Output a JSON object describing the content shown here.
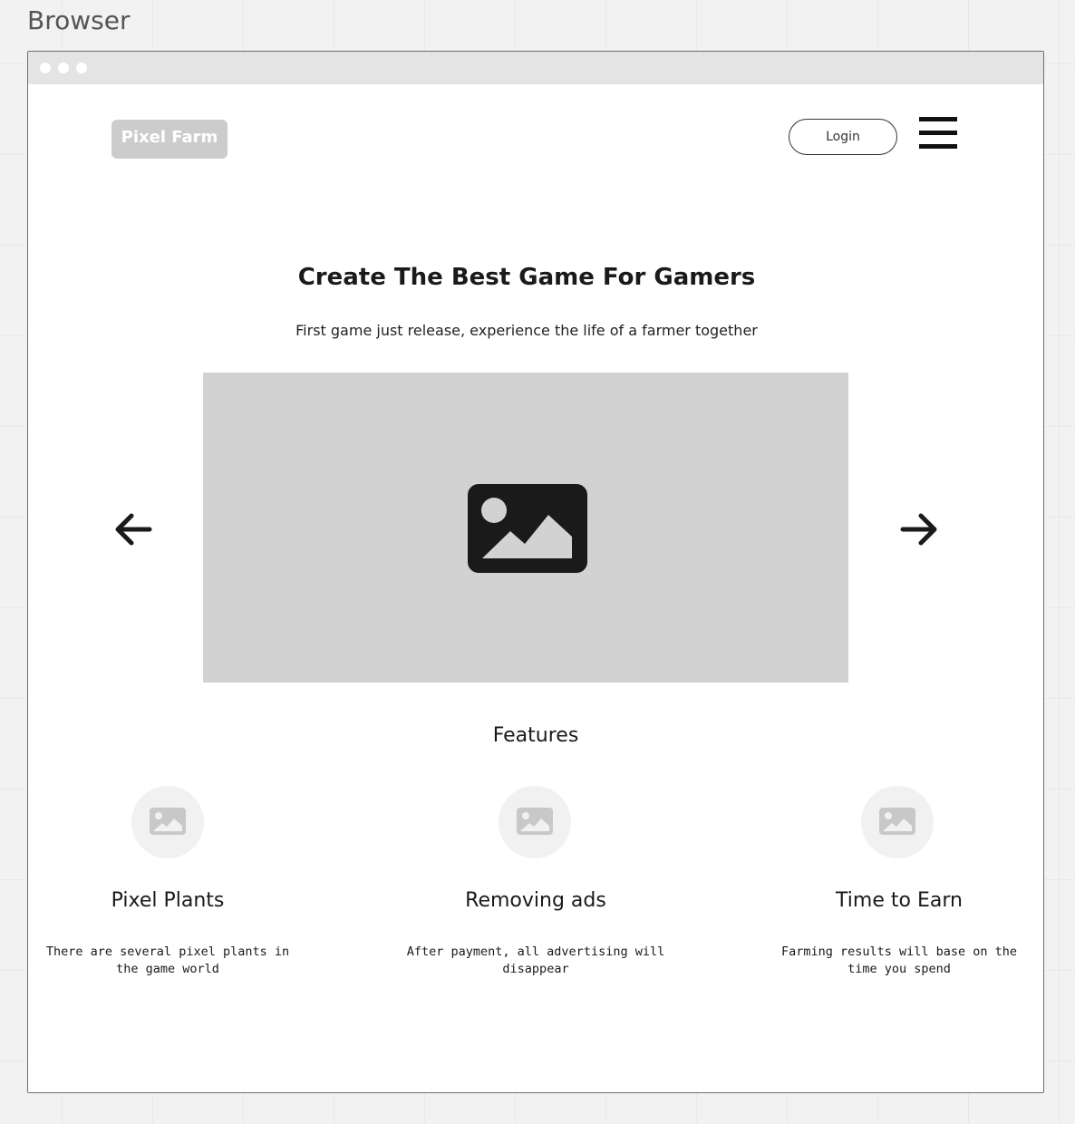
{
  "frame": {
    "title": "Browser"
  },
  "header": {
    "logo_text": "Pixel Farm",
    "login_label": "Login",
    "menu_icon": "hamburger-icon"
  },
  "hero": {
    "title": "Create The Best Game For Gamers",
    "subtitle": "First game just release, experience the life of a farmer together"
  },
  "carousel": {
    "image_icon": "image-placeholder-icon",
    "prev_icon": "arrow-left-icon",
    "next_icon": "arrow-right-icon"
  },
  "features": {
    "heading": "Features",
    "items": [
      {
        "icon": "image-placeholder-icon",
        "title": "Pixel Plants",
        "description": "There are several pixel plants in the game world"
      },
      {
        "icon": "image-placeholder-icon",
        "title": "Removing ads",
        "description": "After payment, all advertising will disappear"
      },
      {
        "icon": "image-placeholder-icon",
        "title": "Time to Earn",
        "description": "Farming results will base on the time you spend"
      }
    ]
  },
  "colors": {
    "canvas_background": "#f2f2f2",
    "logo_background": "#cccccc",
    "image_placeholder": "#d2d2d2",
    "text": "#1a1a1a"
  }
}
